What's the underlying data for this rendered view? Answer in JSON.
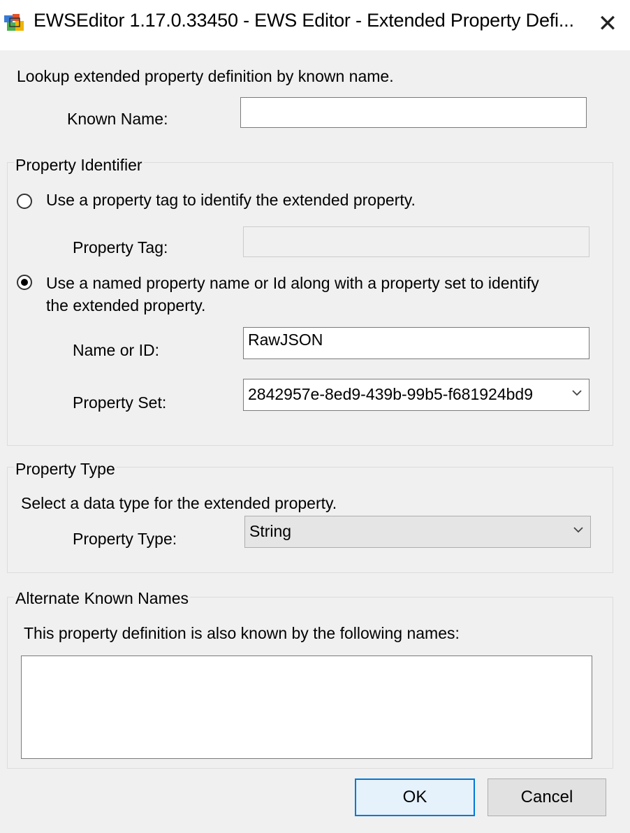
{
  "window": {
    "title": "EWSEditor 1.17.0.33450 - EWS Editor - Extended Property Defi...",
    "close_glyph": "✕"
  },
  "lookup": {
    "description": "Lookup extended property definition by known name.",
    "known_name_label": "Known Name:",
    "known_name_value": ""
  },
  "property_identifier": {
    "group_label": "Property Identifier",
    "tag_option_label": "Use a property tag to identify the extended property.",
    "property_tag_label": "Property Tag:",
    "property_tag_value": "",
    "named_option_label_line1": "Use a named property name or Id along with a property set to identify",
    "named_option_label_line2": "the extended property.",
    "selected_option": "named",
    "name_or_id_label": "Name or ID:",
    "name_or_id_value": "RawJSON",
    "property_set_label": "Property Set:",
    "property_set_value": "2842957e-8ed9-439b-99b5-f681924bd9"
  },
  "property_type": {
    "group_label": "Property Type",
    "description": "Select a data type for the extended property.",
    "type_label": "Property Type:",
    "type_value": "String"
  },
  "alternate_names": {
    "group_label": "Alternate Known Names",
    "description": "This property definition is also known by the following names:",
    "items": []
  },
  "buttons": {
    "ok": "OK",
    "cancel": "Cancel"
  },
  "icons": {
    "app": "ews-editor-app-icon",
    "close": "close-icon",
    "dropdown": "chevron-down-icon"
  },
  "colors": {
    "dialog_bg": "#f0f0f0",
    "default_button_border": "#0078d7",
    "default_button_bg": "#e5f1fb"
  }
}
